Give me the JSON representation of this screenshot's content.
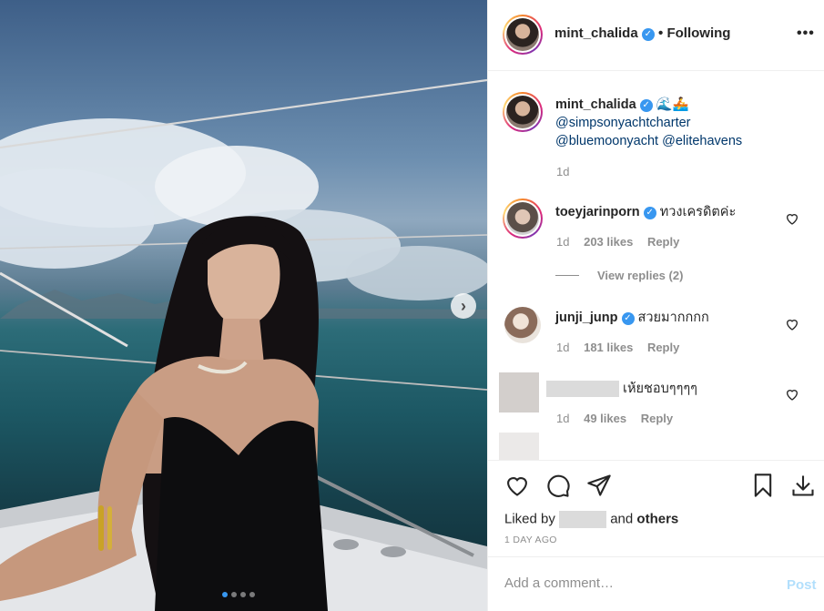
{
  "post": {
    "author": "mint_chalida",
    "follow_status": "• Following",
    "more_icon": "more-horizontal-icon"
  },
  "photo": {
    "carousel_dots": 4,
    "active_dot": 1
  },
  "caption": {
    "author": "mint_chalida",
    "emoji": "🌊🚣",
    "mention_1": "@simpsonyachtcharter",
    "mention_2": "@bluemoonyacht",
    "mention_3": "@elitehavens",
    "age": "1d"
  },
  "comments": [
    {
      "author": "toeyjarinporn",
      "text": "ทวงเครดิตค่ะ",
      "age": "1d",
      "likes": "203 likes",
      "reply_label": "Reply"
    },
    {
      "author": "junji_junp",
      "text": "สวยมากกกก",
      "age": "1d",
      "likes": "181 likes",
      "reply_label": "Reply"
    },
    {
      "author": "",
      "text": "เห้ยชอบๆๆๆๆ",
      "age": "1d",
      "likes": "49 likes",
      "reply_label": "Reply"
    }
  ],
  "view_replies": "View replies (2)",
  "actions": {
    "liked_prefix": "Liked by",
    "liked_and": "and",
    "liked_others": "others",
    "timestamp": "1 DAY AGO"
  },
  "comment_box": {
    "placeholder": "Add a comment…",
    "post_label": "Post"
  },
  "colors": {
    "link": "#00376b",
    "verified": "#3897f0",
    "post_disabled": "#b2dffc",
    "muted": "#8e8e8e"
  }
}
